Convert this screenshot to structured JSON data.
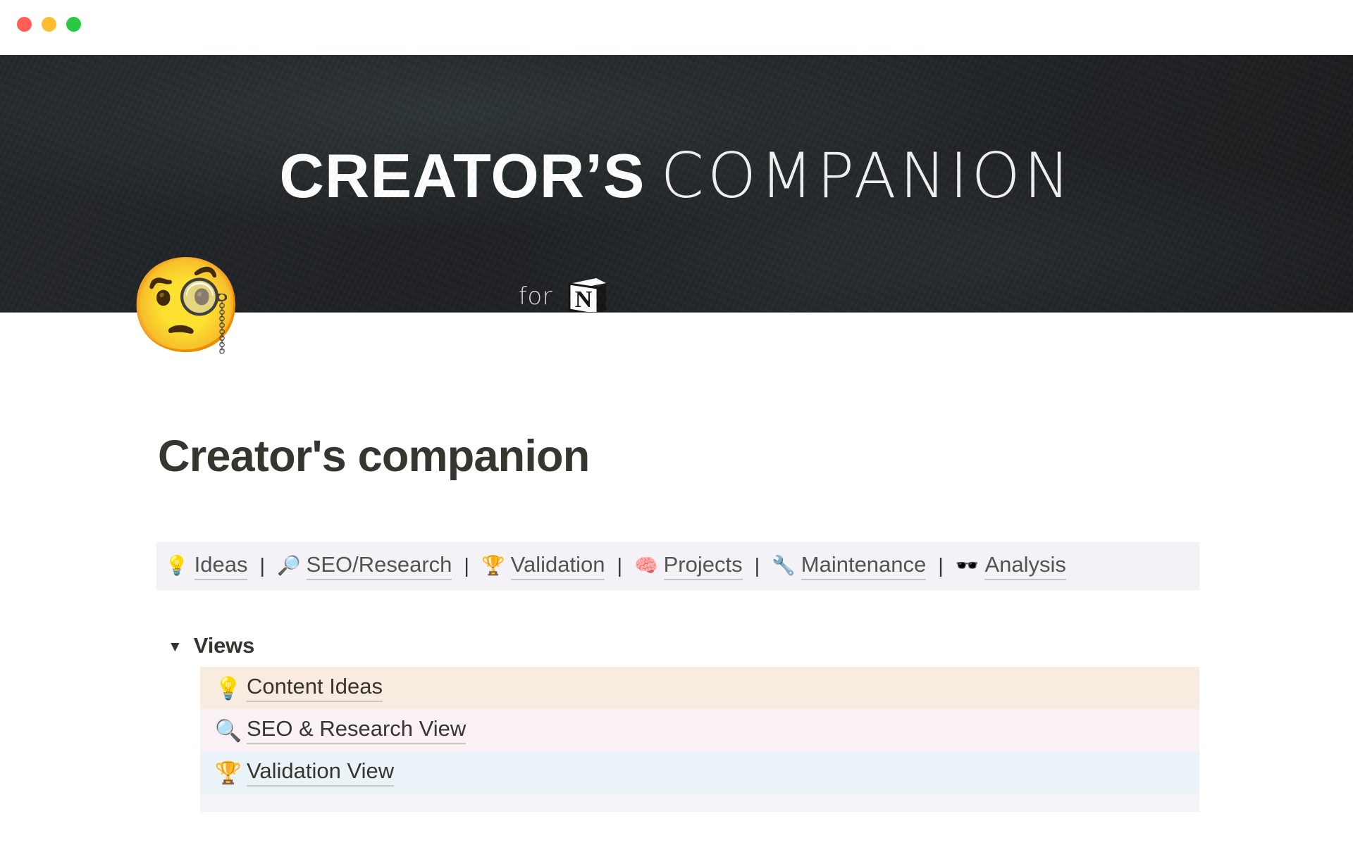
{
  "window": {
    "traffic_lights": [
      {
        "name": "close",
        "color": "#ff5f57"
      },
      {
        "name": "minimize",
        "color": "#febc2e"
      },
      {
        "name": "maximize",
        "color": "#28c840"
      }
    ]
  },
  "cover": {
    "logo_bold": "CREATOR’S",
    "logo_thin": "COMPANION",
    "for_label": "for",
    "brand_mark": "notion-logo",
    "background_color": "#1f2224"
  },
  "page": {
    "icon": "🧐",
    "icon_name": "face-with-monocle-emoji",
    "title": "Creator's companion"
  },
  "quick_nav": {
    "separator": "|",
    "background_color": "#f4f2f7",
    "items": [
      {
        "emoji": "💡",
        "icon_name": "light-bulb-icon",
        "label": "Ideas"
      },
      {
        "emoji": "🔎",
        "icon_name": "magnifying-glass-icon",
        "label": "SEO/Research"
      },
      {
        "emoji": "🏆",
        "icon_name": "trophy-icon",
        "label": "Validation"
      },
      {
        "emoji": "🧠",
        "icon_name": "brain-icon",
        "label": "Projects"
      },
      {
        "emoji": "🔧",
        "icon_name": "wrench-icon",
        "label": "Maintenance"
      },
      {
        "emoji": "🕶️",
        "icon_name": "sunglasses-icon",
        "label": "Analysis"
      }
    ]
  },
  "views_section": {
    "caret": "▼",
    "title": "Views",
    "rows": [
      {
        "emoji": "💡",
        "icon_name": "light-bulb-icon",
        "label": "Content Ideas",
        "background_color": "#f8ece1"
      },
      {
        "emoji": "🔍",
        "icon_name": "magnifying-glass-left-icon",
        "label": "SEO & Research View",
        "background_color": "#faf1f4"
      },
      {
        "emoji": "🏆",
        "icon_name": "trophy-icon",
        "label": "Validation View",
        "background_color": "#e9f3f8"
      },
      {
        "emoji": "",
        "icon_name": "partial-row",
        "label": "",
        "background_color": "#f5f3f7"
      }
    ]
  }
}
